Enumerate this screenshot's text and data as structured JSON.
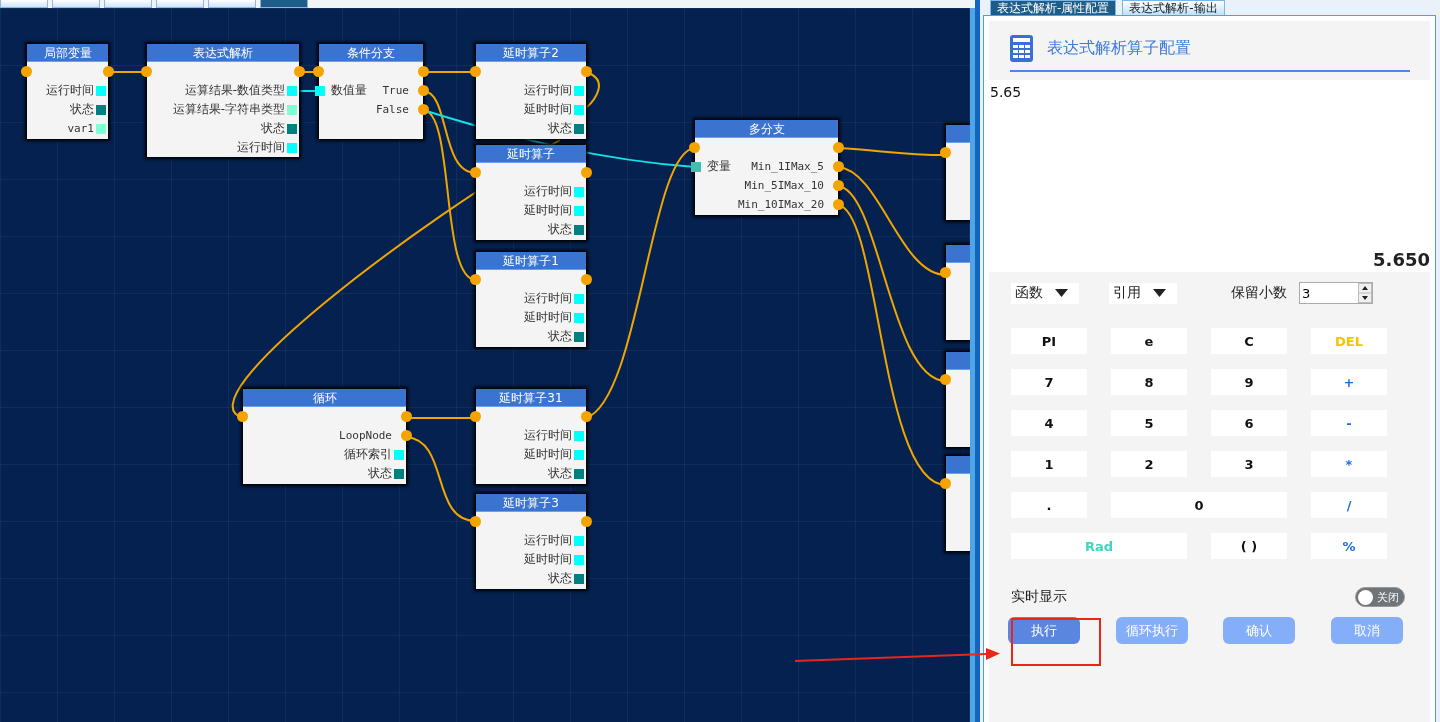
{
  "flow_tabs": [
    {
      "selected": false
    },
    {
      "selected": false
    },
    {
      "selected": false
    },
    {
      "selected": false
    },
    {
      "selected": false
    },
    {
      "selected": true
    }
  ],
  "nodes": [
    {
      "title": "局部变量",
      "rows": [
        {
          "in": {
            "kind": "flow"
          },
          "out": {
            "kind": "flow"
          }
        },
        {
          "label": "运行时间",
          "out": {
            "kind": "data",
            "color": "#00ffff"
          }
        },
        {
          "label": "状态",
          "out": {
            "kind": "data",
            "color": "#008080"
          }
        },
        {
          "label": "var1",
          "out": {
            "kind": "data",
            "color": "#7fffd4"
          }
        }
      ]
    },
    {
      "title": "表达式解析",
      "rows": [
        {
          "in": {
            "kind": "flow"
          },
          "out": {
            "kind": "flow"
          }
        },
        {
          "label": "运算结果-数值类型",
          "out": {
            "kind": "data",
            "color": "#00ffff"
          }
        },
        {
          "label": "运算结果-字符串类型",
          "out": {
            "kind": "data",
            "color": "#7fffd4"
          }
        },
        {
          "label": "状态",
          "out": {
            "kind": "data",
            "color": "#008080"
          }
        },
        {
          "label": "运行时间",
          "out": {
            "kind": "data",
            "color": "#00ffff"
          }
        }
      ]
    },
    {
      "title": "条件分支",
      "rows": [
        {
          "in": {
            "kind": "flow"
          },
          "out": {
            "kind": "flow"
          }
        },
        {
          "left_label": "数值量",
          "label": "True",
          "in": {
            "kind": "data",
            "color": "#00ffff"
          },
          "out": {
            "kind": "flow"
          }
        },
        {
          "label": "False",
          "out": {
            "kind": "flow"
          }
        }
      ]
    },
    {
      "title": "延时算子2",
      "rows": [
        {
          "in": {
            "kind": "flow"
          },
          "out": {
            "kind": "flow"
          }
        },
        {
          "label": "运行时间",
          "out": {
            "kind": "data",
            "color": "#00ffff"
          }
        },
        {
          "label": "延时时间",
          "out": {
            "kind": "data",
            "color": "#00ffff"
          }
        },
        {
          "label": "状态",
          "out": {
            "kind": "data",
            "color": "#008080"
          }
        }
      ]
    },
    {
      "title": "延时算子",
      "rows": [
        {
          "in": {
            "kind": "flow"
          },
          "out": {
            "kind": "flow"
          }
        },
        {
          "label": "运行时间",
          "out": {
            "kind": "data",
            "color": "#00ffff"
          }
        },
        {
          "label": "延时时间",
          "out": {
            "kind": "data",
            "color": "#00ffff"
          }
        },
        {
          "label": "状态",
          "out": {
            "kind": "data",
            "color": "#008080"
          }
        }
      ]
    },
    {
      "title": "延时算子1",
      "rows": [
        {
          "in": {
            "kind": "flow"
          },
          "out": {
            "kind": "flow"
          }
        },
        {
          "label": "运行时间",
          "out": {
            "kind": "data",
            "color": "#00ffff"
          }
        },
        {
          "label": "延时时间",
          "out": {
            "kind": "data",
            "color": "#00ffff"
          }
        },
        {
          "label": "状态",
          "out": {
            "kind": "data",
            "color": "#008080"
          }
        }
      ]
    },
    {
      "title": "多分支",
      "rows": [
        {
          "in": {
            "kind": "flow"
          },
          "out": {
            "kind": "flow"
          }
        },
        {
          "left_label": "变量",
          "label": "Min_1IMax_5",
          "in": {
            "kind": "data",
            "color": "#40c0b0"
          },
          "out": {
            "kind": "flow"
          }
        },
        {
          "label": "Min_5IMax_10",
          "out": {
            "kind": "flow"
          }
        },
        {
          "label": "Min_10IMax_20",
          "out": {
            "kind": "flow"
          }
        }
      ]
    },
    {
      "title": "循环",
      "rows": [
        {
          "in": {
            "kind": "flow"
          },
          "out": {
            "kind": "flow"
          }
        },
        {
          "label": "LoopNode",
          "out": {
            "kind": "flow"
          }
        },
        {
          "label": "循环索引",
          "out": {
            "kind": "data",
            "color": "#00ffff"
          }
        },
        {
          "label": "状态",
          "out": {
            "kind": "data",
            "color": "#008080"
          }
        }
      ]
    },
    {
      "title": "延时算子31",
      "rows": [
        {
          "in": {
            "kind": "flow"
          },
          "out": {
            "kind": "flow"
          }
        },
        {
          "label": "运行时间",
          "out": {
            "kind": "data",
            "color": "#00ffff"
          }
        },
        {
          "label": "延时时间",
          "out": {
            "kind": "data",
            "color": "#00ffff"
          }
        },
        {
          "label": "状态",
          "out": {
            "kind": "data",
            "color": "#008080"
          }
        }
      ]
    },
    {
      "title": "延时算子3",
      "rows": [
        {
          "in": {
            "kind": "flow"
          },
          "out": {
            "kind": "flow"
          }
        },
        {
          "label": "运行时间",
          "out": {
            "kind": "data",
            "color": "#00ffff"
          }
        },
        {
          "label": "延时时间",
          "out": {
            "kind": "data",
            "color": "#00ffff"
          }
        },
        {
          "label": "状态",
          "out": {
            "kind": "data",
            "color": "#008080"
          }
        }
      ]
    },
    {
      "rows": [
        {
          "in": {
            "kind": "flow"
          }
        }
      ]
    },
    {
      "rows": [
        {
          "in": {
            "kind": "flow"
          }
        }
      ]
    },
    {
      "rows": [
        {
          "in": {
            "kind": "flow"
          }
        }
      ]
    },
    {
      "rows": [
        {
          "in": {
            "kind": "flow"
          }
        }
      ]
    }
  ],
  "panel": {
    "tabs": [
      {
        "label": "表达式解析-属性配置",
        "selected": true
      },
      {
        "label": "表达式解析-输出",
        "selected": false
      }
    ],
    "title": "表达式解析算子配置",
    "expression": "5.65",
    "result": "5.650",
    "dropdowns": [
      {
        "label": "函数"
      },
      {
        "label": "引用"
      }
    ],
    "decimals": {
      "label": "保留小数",
      "value": "3"
    },
    "keys": [
      {
        "label": "PI",
        "kind": "plain"
      },
      {
        "label": "e",
        "kind": "plain"
      },
      {
        "label": "C",
        "kind": "plain"
      },
      {
        "label": "DEL",
        "kind": "delete"
      },
      {
        "label": "7",
        "kind": "plain"
      },
      {
        "label": "8",
        "kind": "plain"
      },
      {
        "label": "9",
        "kind": "plain"
      },
      {
        "label": "+",
        "kind": "operator"
      },
      {
        "label": "4",
        "kind": "plain"
      },
      {
        "label": "5",
        "kind": "plain"
      },
      {
        "label": "6",
        "kind": "plain"
      },
      {
        "label": "-",
        "kind": "operator"
      },
      {
        "label": "1",
        "kind": "plain"
      },
      {
        "label": "2",
        "kind": "plain"
      },
      {
        "label": "3",
        "kind": "plain"
      },
      {
        "label": "*",
        "kind": "operator"
      },
      {
        "label": ".",
        "kind": "plain"
      },
      {
        "label": "0",
        "kind": "plain",
        "wide": true
      },
      {
        "label": "/",
        "kind": "operator"
      },
      {
        "label": "Rad",
        "kind": "mode",
        "wide": true
      },
      {
        "label": "( )",
        "kind": "plain"
      },
      {
        "label": "%",
        "kind": "operator"
      }
    ],
    "live": {
      "label": "实时显示",
      "toggle": {
        "label": "关闭",
        "on": false
      }
    },
    "buttons": [
      {
        "label": "执行",
        "kind": "primary"
      },
      {
        "label": "循环执行",
        "kind": "secondary"
      },
      {
        "label": "确认",
        "kind": "secondary"
      },
      {
        "label": "取消",
        "kind": "secondary"
      }
    ]
  }
}
